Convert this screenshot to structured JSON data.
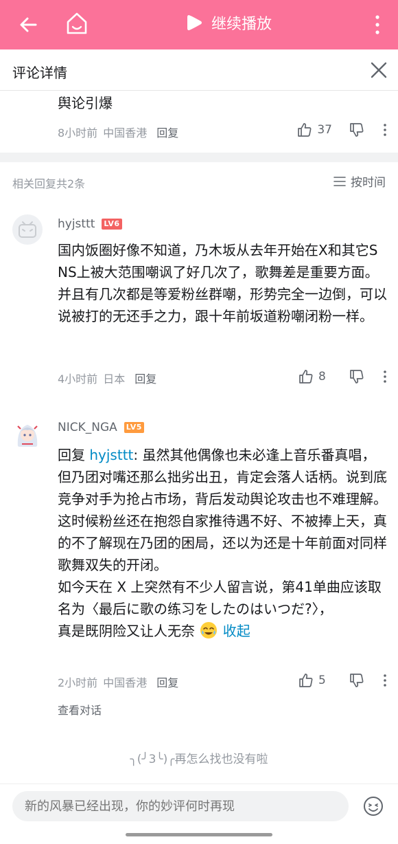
{
  "colors": {
    "brand_pink": "#fb7299",
    "link_blue": "#008ac5",
    "muted": "#9499a0"
  },
  "topbar": {
    "play_label": "继续播放",
    "back_icon": "back-arrow-icon",
    "home_icon": "home-icon",
    "more_icon": "more-vertical-icon"
  },
  "header": {
    "title": "评论详情"
  },
  "parent_comment": {
    "text_tail": "舆论引爆",
    "time": "8小时前",
    "location": "中国香港",
    "reply_label": "回复",
    "likes": "37"
  },
  "replies_header": {
    "count_label": "相关回复共2条",
    "sort_label": "按时间"
  },
  "replies": [
    {
      "username": "hyjsttt",
      "level": "LV6",
      "text": "国内饭圈好像不知道，乃木坂从去年开始在X和其它SNS上被大范围嘲讽了好几次了，歌舞差是重要方面。并且有几次都是等爱粉丝群嘲，形势完全一边倒，可以说被打的无还手之力，跟十年前坂道粉嘲闭粉一样。",
      "time": "4小时前",
      "location": "日本",
      "reply_label": "回复",
      "likes": "8"
    },
    {
      "username": "NICK_NGA",
      "level": "LV5",
      "reply_prefix": "回复 ",
      "reply_to": "hyjsttt",
      "text_part1": ": 虽然其他偶像也未必逢上音乐番真唱，但乃团对嘴还那么拙劣出丑，肯定会落人话柄。说到底竞争对手为抢占市场，背后发动舆论攻击也不难理解。这时候粉丝还在抱怨自家推待遇不好、不被捧上天，真的不了解现在乃团的困局，还以为还是十年前面对同样歌舞双失的开闭。",
      "text_part2": "如今天在 X 上突然有不少人留言说，第41单曲应该取名为〈最后に歌の练习をしたのはいつだ?〉，",
      "text_part3": "真是既阴险又让人无奈",
      "fold_label": "收起",
      "time": "2小时前",
      "location": "中国香港",
      "reply_label": "回复",
      "likes": "5",
      "view_dialog": "查看对话"
    }
  ],
  "end_note": "╮(╯3╰)╭再怎么找也没有啦",
  "composer": {
    "placeholder": "新的风暴已经出现，你的妙评何时再现"
  }
}
